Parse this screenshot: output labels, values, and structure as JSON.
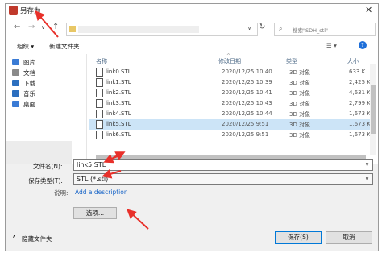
{
  "window": {
    "title": "另存为",
    "close_glyph": "✕"
  },
  "nav": {
    "back": "←",
    "forward": "→",
    "dropdown": "∨",
    "up": "↑",
    "addr_chevron": "∨",
    "refresh": "↻",
    "search_placeholder": "搜索\"SDH_stl\""
  },
  "toolbar": {
    "organize": "组织 ▾",
    "new_folder": "新建文件夹",
    "view_glyph": "☰ ▾",
    "help": "?"
  },
  "sidebar": {
    "items": [
      {
        "label": "图片",
        "color": "#3a7bd5"
      },
      {
        "label": "文档",
        "color": "#8a8a8a"
      },
      {
        "label": "下载",
        "color": "#2c6fbf"
      },
      {
        "label": "音乐",
        "color": "#2c6fbf"
      },
      {
        "label": "桌面",
        "color": "#3a7bd5"
      }
    ]
  },
  "columns": {
    "name": "名称",
    "date": "修改日期",
    "type": "类型",
    "size": "大小"
  },
  "files": [
    {
      "name": "link0.STL",
      "date": "2020/12/25 10:40",
      "type": "3D 对象",
      "size": "633 K"
    },
    {
      "name": "link1.STL",
      "date": "2020/12/25 10:39",
      "type": "3D 对象",
      "size": "2,425 K"
    },
    {
      "name": "link2.STL",
      "date": "2020/12/25 10:41",
      "type": "3D 对象",
      "size": "4,631 K"
    },
    {
      "name": "link3.STL",
      "date": "2020/12/25 10:43",
      "type": "3D 对象",
      "size": "2,799 K"
    },
    {
      "name": "link4.STL",
      "date": "2020/12/25 10:44",
      "type": "3D 对象",
      "size": "1,673 K"
    },
    {
      "name": "link5.STL",
      "date": "2020/12/25 9:51",
      "type": "3D 对象",
      "size": "1,673 K"
    },
    {
      "name": "link6.STL",
      "date": "2020/12/25 9:51",
      "type": "3D 对象",
      "size": "1,673 K"
    }
  ],
  "selected_index": 5,
  "form": {
    "filename_label": "文件名(N):",
    "filename_value": "link5.STL",
    "filetype_label": "保存类型(T):",
    "filetype_value": "STL (*.stl)",
    "desc_label": "说明:",
    "desc_link": "Add a description",
    "options_button": "选项...",
    "hide_folders": "隐藏文件夹",
    "hide_chevron": "∧",
    "save_button": "保存(S)",
    "cancel_button": "取消"
  },
  "colors": {
    "arrow": "#e8302a",
    "selected_row": "#cce4f7",
    "link": "#1a66c8"
  }
}
